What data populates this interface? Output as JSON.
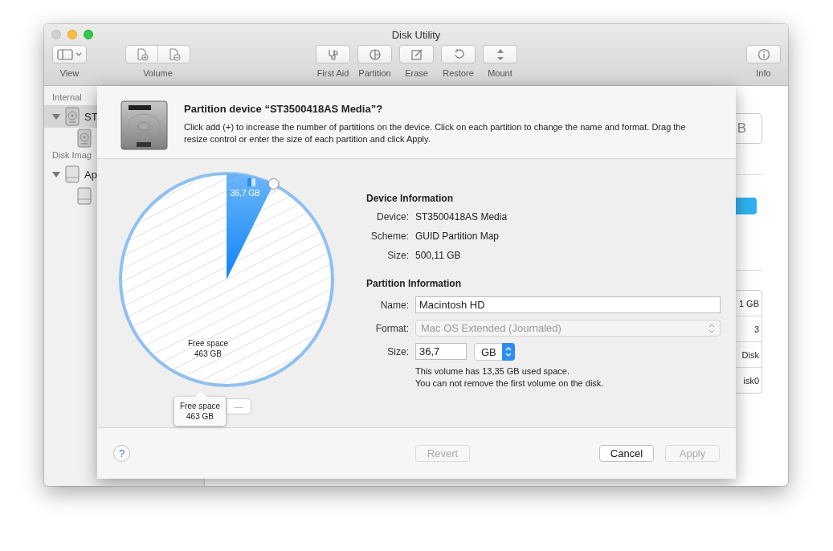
{
  "window": {
    "title": "Disk Utility"
  },
  "toolbar": [
    {
      "label": "View"
    },
    {
      "label": "Volume"
    },
    {
      "label": "First Aid"
    },
    {
      "label": "Partition"
    },
    {
      "label": "Erase"
    },
    {
      "label": "Restore"
    },
    {
      "label": "Mount"
    },
    {
      "label": "Info"
    }
  ],
  "sidebar": {
    "sections": [
      {
        "label": "Internal",
        "items": [
          {
            "label": "ST",
            "selected": true,
            "expanded": true,
            "children": [
              {
                "kind": "volume"
              }
            ]
          }
        ]
      },
      {
        "label": "Disk Imag",
        "items": [
          {
            "label": "Ap",
            "selected": false,
            "expanded": true,
            "children": [
              {
                "kind": "volume"
              }
            ]
          }
        ]
      }
    ]
  },
  "detail": {
    "box_text": "B",
    "rows": [
      "1 GB",
      "3",
      "Disk",
      "isk0"
    ]
  },
  "sheet": {
    "title": "Partition device “ST3500418AS Media”?",
    "message": "Click add (+) to increase the number of partitions on the device. Click on each partition to change the name and format. Drag the resize control or enter the size of each partition and click Apply.",
    "pie": {
      "volume_label": "36,7 GB",
      "free_name": "Free space",
      "free_size": "463 GB"
    },
    "popover": {
      "name": "Free space",
      "size": "463 GB"
    },
    "remove_button": "—",
    "device_heading": "Device Information",
    "device_rows": [
      {
        "label": "Device:",
        "value": "ST3500418AS Media"
      },
      {
        "label": "Scheme:",
        "value": "GUID Partition Map"
      },
      {
        "label": "Size:",
        "value": "500,11 GB"
      }
    ],
    "partition_heading": "Partition Information",
    "name": {
      "label": "Name:",
      "value": "Macintosh HD"
    },
    "format": {
      "label": "Format:",
      "value": "Mac OS Extended (Journaled)",
      "disabled": true
    },
    "size": {
      "label": "Size:",
      "value": "36,7",
      "unit": "GB"
    },
    "notes": [
      "This volume has 13,35 GB used space.",
      "You can not remove the first volume on the disk."
    ],
    "help": "?",
    "buttons": [
      {
        "label": "Revert",
        "disabled": true,
        "kind": "left"
      },
      {
        "label": "Cancel",
        "disabled": false,
        "kind": "right"
      },
      {
        "label": "Apply",
        "disabled": true,
        "kind": "right"
      }
    ]
  }
}
